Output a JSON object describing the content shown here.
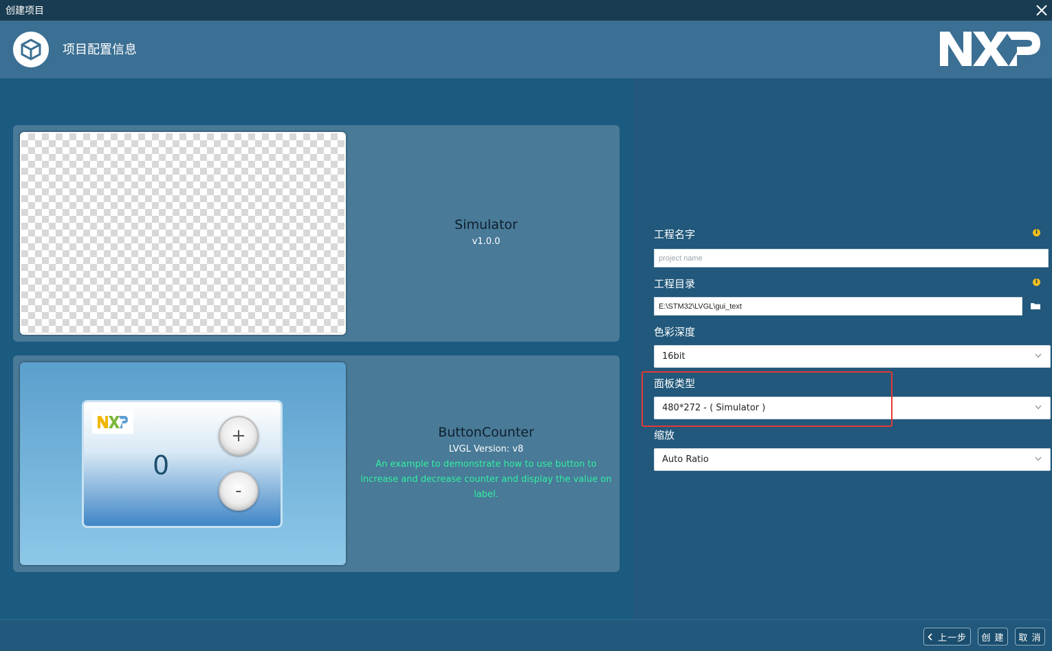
{
  "window": {
    "title": "创建项目"
  },
  "header": {
    "title": "项目配置信息",
    "brand": "NXP"
  },
  "templates": [
    {
      "name": "Simulator",
      "version": "v1.0.0",
      "description": ""
    },
    {
      "name": "ButtonCounter",
      "version": "LVGL Version: v8",
      "description": "An example to demonstrate how to use button to increase and decrease counter and display the value on label.",
      "preview": {
        "logo": "NXP",
        "counter": "0",
        "plus": "+",
        "minus": "-"
      }
    }
  ],
  "form": {
    "project_name": {
      "label": "工程名字",
      "value": "",
      "placeholder": "project name"
    },
    "project_dir": {
      "label": "工程目录",
      "value": "E:\\STM32\\LVGL\\gui_text"
    },
    "color_depth": {
      "label": "色彩深度",
      "value": "16bit"
    },
    "panel_type": {
      "label": "面板类型",
      "value": "480*272 - ( Simulator )"
    },
    "scale": {
      "label": "缩放",
      "value": "Auto Ratio"
    }
  },
  "footer": {
    "prev": "上一步",
    "create": "创 建",
    "cancel": "取 消"
  },
  "colors": {
    "titlebar": "#1a3c52",
    "header": "#3b6f93",
    "card": "#497a98",
    "desc": "#31f0a0",
    "highlight": "#e53935"
  },
  "icons": {
    "app": "cube-icon",
    "close": "close-icon",
    "info": "info-icon",
    "folder": "folder-icon",
    "dropdown": "chevron-down-icon",
    "back": "chevron-left-icon"
  }
}
